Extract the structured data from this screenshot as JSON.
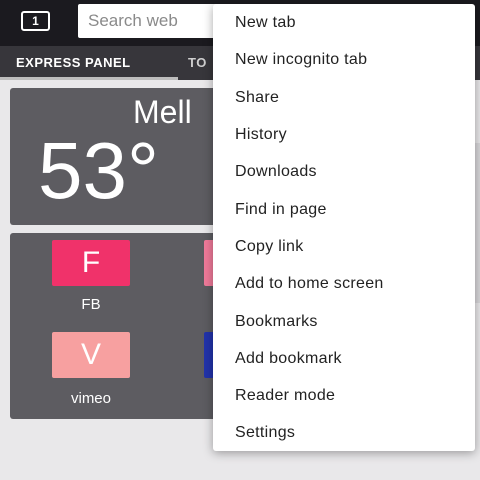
{
  "toolbar": {
    "tab_count": "1",
    "search_placeholder": "Search web"
  },
  "tabstrip": {
    "tabs": [
      {
        "label": "EXPRESS PANEL"
      },
      {
        "label": "TO"
      }
    ]
  },
  "weather": {
    "city": "Mell",
    "temperature": "53°"
  },
  "speed_dial": [
    {
      "letter": "F",
      "label": "FB",
      "color": "#f0326a"
    },
    {
      "letter": "",
      "label": "",
      "color": "#f07a9a"
    },
    {
      "letter": "V",
      "label": "vimeo",
      "color": "#f7a0a0"
    },
    {
      "letter": "",
      "label": "",
      "color": "#2233aa"
    }
  ],
  "menu": {
    "items": [
      {
        "label": "New tab"
      },
      {
        "label": "New incognito tab"
      },
      {
        "label": "Share"
      },
      {
        "label": "History"
      },
      {
        "label": "Downloads"
      },
      {
        "label": "Find in page"
      },
      {
        "label": "Copy link"
      },
      {
        "label": "Add to home screen"
      },
      {
        "label": "Bookmarks"
      },
      {
        "label": "Add bookmark"
      },
      {
        "label": "Reader mode"
      },
      {
        "label": "Settings"
      }
    ]
  }
}
